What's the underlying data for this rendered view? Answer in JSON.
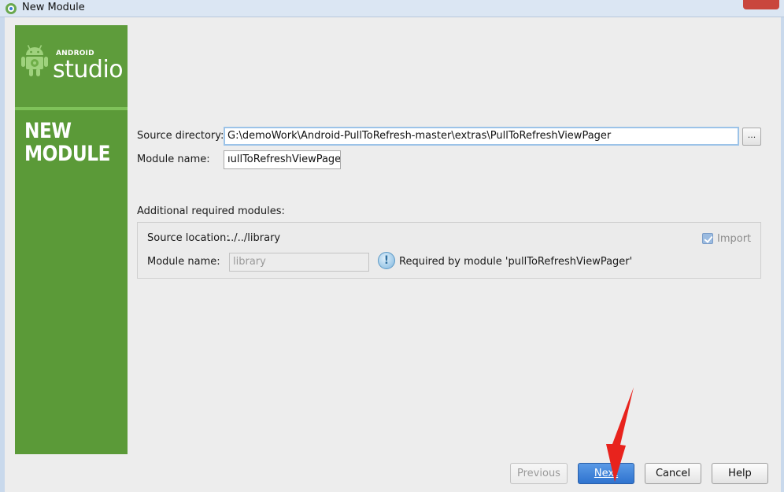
{
  "window": {
    "title": "New Module"
  },
  "sidebar": {
    "logo_small": "ANDROID",
    "logo_big": "studio",
    "heading": "NEW MODULE"
  },
  "form": {
    "source_directory_label": "Source directory:",
    "source_directory_value": "G:\\demoWork\\Android-PullToRefresh-master\\extras\\PullToRefreshViewPager",
    "browse_label": "...",
    "module_name_label": "Module name:",
    "module_name_value": "ıullToRefreshViewPager"
  },
  "additional": {
    "heading": "Additional required modules:",
    "source_location_label": "Source location:",
    "source_location_value": "../../library",
    "import_label": "Import",
    "import_checked": true,
    "module_name_label": "Module name:",
    "module_name_value": "library",
    "required_message": "Required by module 'pullToRefreshViewPager'"
  },
  "buttons": {
    "previous": "Previous",
    "next": "Next",
    "cancel": "Cancel",
    "help": "Help"
  },
  "colors": {
    "sidebar_green": "#5b9a38",
    "primary_blue": "#2f73cf",
    "annotation_arrow": "#e8231d"
  }
}
